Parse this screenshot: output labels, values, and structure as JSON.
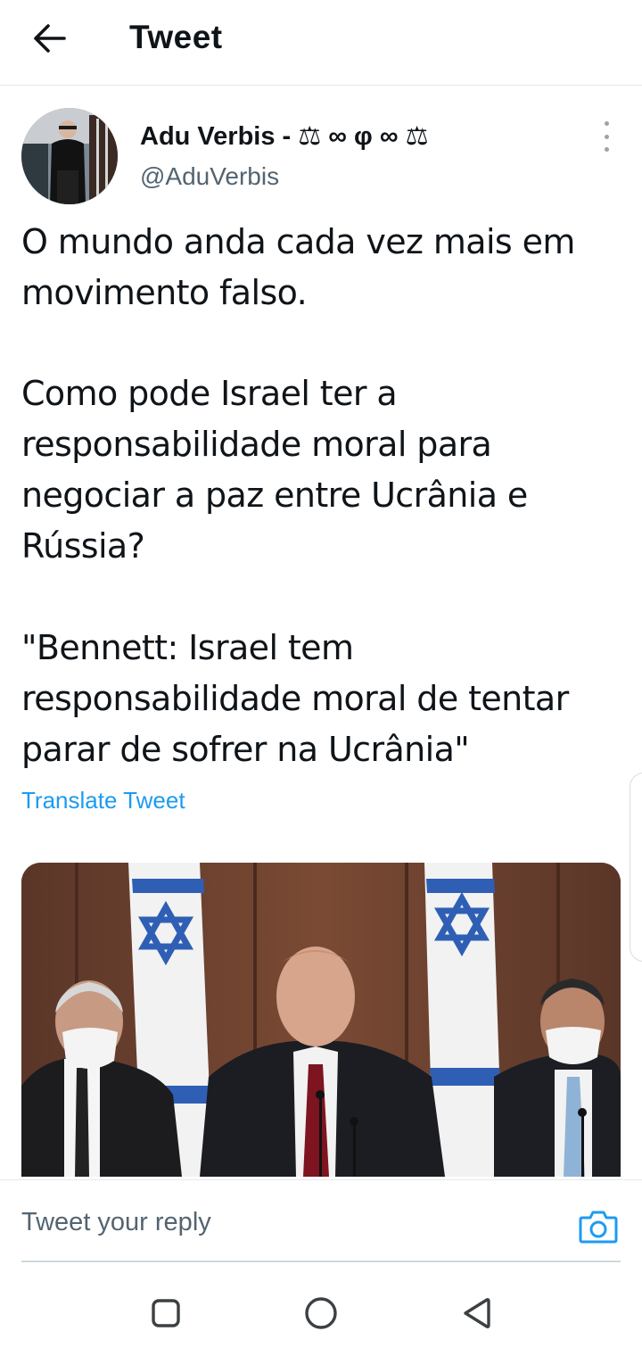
{
  "header": {
    "back_icon": "arrow-left-icon",
    "title": "Tweet"
  },
  "author": {
    "name": "Adu Verbis - ⚖ ∞ φ ∞ ⚖",
    "handle": "@AduVerbis",
    "more_icon": "more-vertical-icon"
  },
  "tweet": {
    "paragraphs": [
      "O mundo anda cada vez mais em movimento falso.",
      "Como pode Israel ter a responsabilidade moral para negociar a paz entre Ucrânia e Rússia?",
      "\"Bennett: Israel tem responsabilidade moral de tentar parar de sofrer na Ucrânia\""
    ],
    "translate_label": "Translate Tweet"
  },
  "reply": {
    "placeholder": "Tweet your reply",
    "camera_icon": "camera-icon"
  },
  "navbar": {
    "recents_icon": "square-icon",
    "home_icon": "circle-icon",
    "back_icon": "triangle-back-icon"
  },
  "colors": {
    "link": "#1d9bf0",
    "secondary_text": "#536471",
    "divider": "#e6e8eb"
  }
}
